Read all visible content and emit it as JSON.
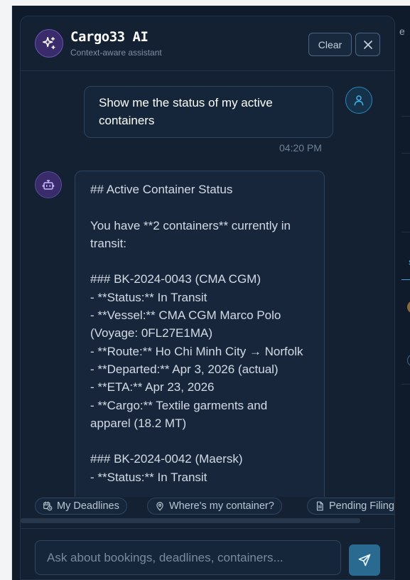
{
  "header": {
    "title": "Cargo33 AI",
    "subtitle": "Context-aware assistant",
    "clear_label": "Clear",
    "icon": "sparkles-icon",
    "close_icon": "close-icon"
  },
  "messages": [
    {
      "role": "user",
      "text": "Show me the status of my active containers",
      "time": "04:20 PM",
      "avatar_icon": "user-icon"
    },
    {
      "role": "assistant",
      "avatar_icon": "bot-icon",
      "text": "## Active Container Status\n\nYou have **2 containers** currently in transit:\n\n### BK-2024-0043 (CMA CGM)\n- **Status:** In Transit\n- **Vessel:** CMA CGM Marco Polo (Voyage: 0FL27E1MA)\n- **Route:** Ho Chi Minh City → Norfolk\n- **Departed:** Apr 3, 2026 (actual)\n- **ETA:** Apr 23, 2026\n- **Cargo:** Textile garments and apparel (18.2 MT)\n\n### BK-2024-0042 (Maersk)\n- **Status:** In Transit"
    }
  ],
  "quick_actions": [
    {
      "label": "My Deadlines",
      "icon": "calendar-clock-icon"
    },
    {
      "label": "Where's my container?",
      "icon": "map-pin-icon"
    },
    {
      "label": "Pending Filings",
      "icon": "document-icon"
    }
  ],
  "composer": {
    "placeholder": "Ask about bookings, deadlines, containers...",
    "send_icon": "send-icon"
  },
  "colors": {
    "panel_bg": "#132133",
    "accent_purple": "#6a55b8",
    "accent_blue": "#2b86b8",
    "send_button": "#2a6a90"
  }
}
